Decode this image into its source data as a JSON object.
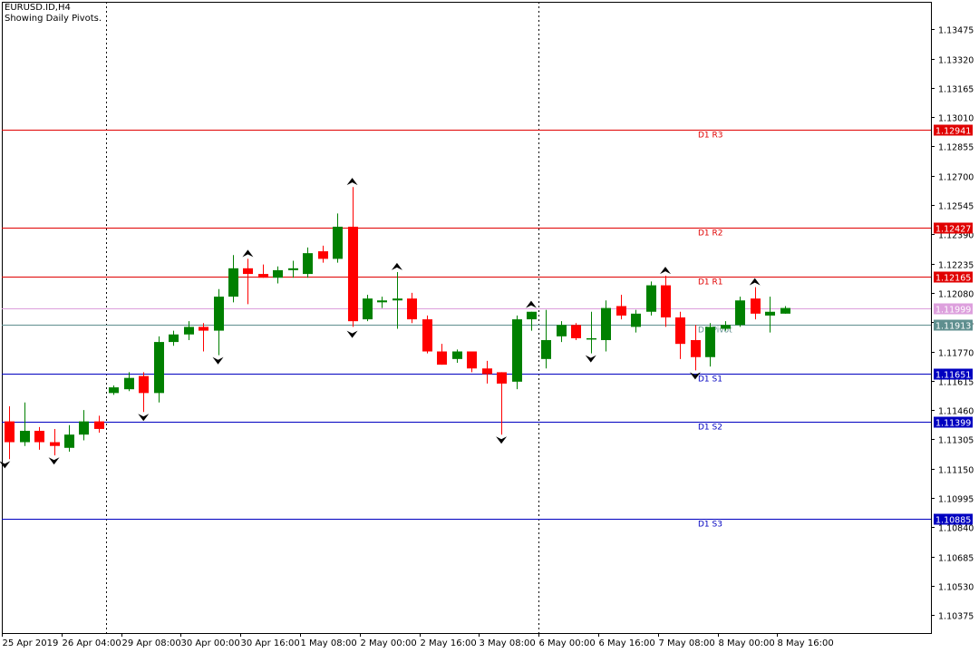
{
  "header": {
    "symbol_line": "EURUSD.ID,H4",
    "indicator_line": "Showing Daily Pivots."
  },
  "colors": {
    "bull": "#008000",
    "bear": "#ff0000",
    "resistance": "#e00000",
    "support": "#0000c0",
    "pivot": "#5f8f8f",
    "current_price": "#dda0dd"
  },
  "chart_data": {
    "type": "candlestick",
    "y_range": [
      1.1028,
      1.1362
    ],
    "y_ticks": [
      "1.13475",
      "1.13320",
      "1.13165",
      "1.13010",
      "1.12855",
      "1.12700",
      "1.12545",
      "1.12390",
      "1.12235",
      "1.12080",
      "1.11925",
      "1.11770",
      "1.11615",
      "1.11460",
      "1.11305",
      "1.11150",
      "1.10995",
      "1.10840",
      "1.10685",
      "1.10530",
      "1.10375"
    ],
    "x_tick_labels": [
      {
        "label": "25 Apr 2019",
        "bar": 0
      },
      {
        "label": "26 Apr 04:00",
        "bar": 4
      },
      {
        "label": "29 Apr 08:00",
        "bar": 8
      },
      {
        "label": "30 Apr 00:00",
        "bar": 12
      },
      {
        "label": "30 Apr 16:00",
        "bar": 16
      },
      {
        "label": "1 May 08:00",
        "bar": 20
      },
      {
        "label": "2 May 00:00",
        "bar": 24
      },
      {
        "label": "2 May 16:00",
        "bar": 28
      },
      {
        "label": "3 May 08:00",
        "bar": 32
      },
      {
        "label": "6 May 00:00",
        "bar": 36
      },
      {
        "label": "6 May 16:00",
        "bar": 40
      },
      {
        "label": "7 May 08:00",
        "bar": 44
      },
      {
        "label": "8 May 00:00",
        "bar": 48
      },
      {
        "label": "8 May 16:00",
        "bar": 52
      }
    ],
    "period_separators_at_bar": [
      7,
      36
    ],
    "candles": [
      {
        "o": 1.114,
        "h": 1.1148,
        "l": 1.112,
        "c": 1.1129
      },
      {
        "o": 1.1129,
        "h": 1.115,
        "l": 1.1127,
        "c": 1.1135
      },
      {
        "o": 1.1135,
        "h": 1.1137,
        "l": 1.1125,
        "c": 1.1129
      },
      {
        "o": 1.1129,
        "h": 1.1136,
        "l": 1.1122,
        "c": 1.1127
      },
      {
        "o": 1.1126,
        "h": 1.1138,
        "l": 1.1124,
        "c": 1.1133
      },
      {
        "o": 1.1133,
        "h": 1.1146,
        "l": 1.113,
        "c": 1.114
      },
      {
        "o": 1.114,
        "h": 1.1143,
        "l": 1.1134,
        "c": 1.1136
      },
      {
        "o": 1.1155,
        "h": 1.1159,
        "l": 1.1154,
        "c": 1.1158
      },
      {
        "o": 1.1157,
        "h": 1.1166,
        "l": 1.1156,
        "c": 1.1163
      },
      {
        "o": 1.1164,
        "h": 1.1166,
        "l": 1.1145,
        "c": 1.1155
      },
      {
        "o": 1.1155,
        "h": 1.1185,
        "l": 1.115,
        "c": 1.1182
      },
      {
        "o": 1.1182,
        "h": 1.1188,
        "l": 1.118,
        "c": 1.1186
      },
      {
        "o": 1.1186,
        "h": 1.1193,
        "l": 1.1183,
        "c": 1.119
      },
      {
        "o": 1.119,
        "h": 1.1192,
        "l": 1.1177,
        "c": 1.1188
      },
      {
        "o": 1.1188,
        "h": 1.121,
        "l": 1.1175,
        "c": 1.1206
      },
      {
        "o": 1.1206,
        "h": 1.1228,
        "l": 1.1203,
        "c": 1.1221
      },
      {
        "o": 1.1221,
        "h": 1.1226,
        "l": 1.1202,
        "c": 1.1218
      },
      {
        "o": 1.1218,
        "h": 1.1223,
        "l": 1.1216,
        "c": 1.1216
      },
      {
        "o": 1.1216,
        "h": 1.1222,
        "l": 1.1213,
        "c": 1.122
      },
      {
        "o": 1.122,
        "h": 1.1225,
        "l": 1.1216,
        "c": 1.1221
      },
      {
        "o": 1.1218,
        "h": 1.1232,
        "l": 1.1216,
        "c": 1.1229
      },
      {
        "o": 1.123,
        "h": 1.1233,
        "l": 1.1224,
        "c": 1.1226
      },
      {
        "o": 1.1226,
        "h": 1.125,
        "l": 1.1224,
        "c": 1.1243
      },
      {
        "o": 1.1243,
        "h": 1.1264,
        "l": 1.119,
        "c": 1.1193
      },
      {
        "o": 1.1194,
        "h": 1.1207,
        "l": 1.1193,
        "c": 1.1205
      },
      {
        "o": 1.1203,
        "h": 1.1206,
        "l": 1.12,
        "c": 1.1204
      },
      {
        "o": 1.1204,
        "h": 1.1219,
        "l": 1.1189,
        "c": 1.1205
      },
      {
        "o": 1.1205,
        "h": 1.1208,
        "l": 1.1192,
        "c": 1.1194
      },
      {
        "o": 1.1194,
        "h": 1.1196,
        "l": 1.1176,
        "c": 1.1177
      },
      {
        "o": 1.1177,
        "h": 1.1181,
        "l": 1.117,
        "c": 1.117
      },
      {
        "o": 1.1173,
        "h": 1.1178,
        "l": 1.1171,
        "c": 1.1177
      },
      {
        "o": 1.1177,
        "h": 1.1177,
        "l": 1.1166,
        "c": 1.1168
      },
      {
        "o": 1.1168,
        "h": 1.1172,
        "l": 1.116,
        "c": 1.1165
      },
      {
        "o": 1.1166,
        "h": 1.1166,
        "l": 1.1133,
        "c": 1.116
      },
      {
        "o": 1.1161,
        "h": 1.1196,
        "l": 1.1157,
        "c": 1.1194
      },
      {
        "o": 1.1194,
        "h": 1.1198,
        "l": 1.1188,
        "c": 1.1198
      },
      {
        "o": 1.1173,
        "h": 1.1199,
        "l": 1.1168,
        "c": 1.1183
      },
      {
        "o": 1.1185,
        "h": 1.1193,
        "l": 1.1182,
        "c": 1.1191
      },
      {
        "o": 1.1191,
        "h": 1.1192,
        "l": 1.1183,
        "c": 1.1184
      },
      {
        "o": 1.1184,
        "h": 1.1198,
        "l": 1.1176,
        "c": 1.1184
      },
      {
        "o": 1.1183,
        "h": 1.1204,
        "l": 1.1177,
        "c": 1.12
      },
      {
        "o": 1.1201,
        "h": 1.1207,
        "l": 1.1194,
        "c": 1.1196
      },
      {
        "o": 1.119,
        "h": 1.1199,
        "l": 1.1187,
        "c": 1.1197
      },
      {
        "o": 1.1198,
        "h": 1.1214,
        "l": 1.1196,
        "c": 1.1212
      },
      {
        "o": 1.1212,
        "h": 1.1217,
        "l": 1.119,
        "c": 1.1195
      },
      {
        "o": 1.1195,
        "h": 1.1198,
        "l": 1.1173,
        "c": 1.1181
      },
      {
        "o": 1.1183,
        "h": 1.1191,
        "l": 1.1167,
        "c": 1.1174
      },
      {
        "o": 1.1174,
        "h": 1.1192,
        "l": 1.1169,
        "c": 1.119
      },
      {
        "o": 1.1189,
        "h": 1.1193,
        "l": 1.1188,
        "c": 1.1191
      },
      {
        "o": 1.1191,
        "h": 1.1206,
        "l": 1.119,
        "c": 1.1204
      },
      {
        "o": 1.1205,
        "h": 1.1211,
        "l": 1.1194,
        "c": 1.1197
      },
      {
        "o": 1.1196,
        "h": 1.1206,
        "l": 1.1187,
        "c": 1.1198
      },
      {
        "o": 1.1197,
        "h": 1.1201,
        "l": 1.1197,
        "c": 1.12
      }
    ],
    "fractals": [
      {
        "bar": -0.3,
        "dir": "down",
        "price": 1.1119
      },
      {
        "bar": 3,
        "dir": "down",
        "price": 1.1121
      },
      {
        "bar": 9,
        "dir": "down",
        "price": 1.1144
      },
      {
        "bar": 14,
        "dir": "down",
        "price": 1.1174
      },
      {
        "bar": 16,
        "dir": "up",
        "price": 1.1227
      },
      {
        "bar": 23,
        "dir": "up",
        "price": 1.1265
      },
      {
        "bar": 23,
        "dir": "down",
        "price": 1.1188
      },
      {
        "bar": 26,
        "dir": "up",
        "price": 1.122
      },
      {
        "bar": 33,
        "dir": "down",
        "price": 1.1132
      },
      {
        "bar": 35,
        "dir": "up",
        "price": 1.12
      },
      {
        "bar": 39,
        "dir": "down",
        "price": 1.1175
      },
      {
        "bar": 44,
        "dir": "up",
        "price": 1.1218
      },
      {
        "bar": 46,
        "dir": "down",
        "price": 1.1166
      },
      {
        "bar": 50,
        "dir": "up",
        "price": 1.1212
      }
    ],
    "pivot_levels": [
      {
        "name": "D1 R3",
        "value": 1.12941,
        "price_label": "1.12941",
        "kind": "resistance"
      },
      {
        "name": "D1 R2",
        "value": 1.12427,
        "price_label": "1.12427",
        "kind": "resistance"
      },
      {
        "name": "D1 R1",
        "value": 1.12165,
        "price_label": "1.12165",
        "kind": "resistance"
      },
      {
        "name": "D1 Pivot",
        "value": 1.11913,
        "price_label": "1.11913",
        "kind": "pivot"
      },
      {
        "name": "D1 S1",
        "value": 1.11651,
        "price_label": "1.11651",
        "kind": "support"
      },
      {
        "name": "D1 S2",
        "value": 1.11399,
        "price_label": "1.11399",
        "kind": "support"
      },
      {
        "name": "D1 S3",
        "value": 1.10885,
        "price_label": "1.10885",
        "kind": "support"
      }
    ],
    "current_price": {
      "value": 1.11999,
      "price_label": "1.11999"
    }
  }
}
